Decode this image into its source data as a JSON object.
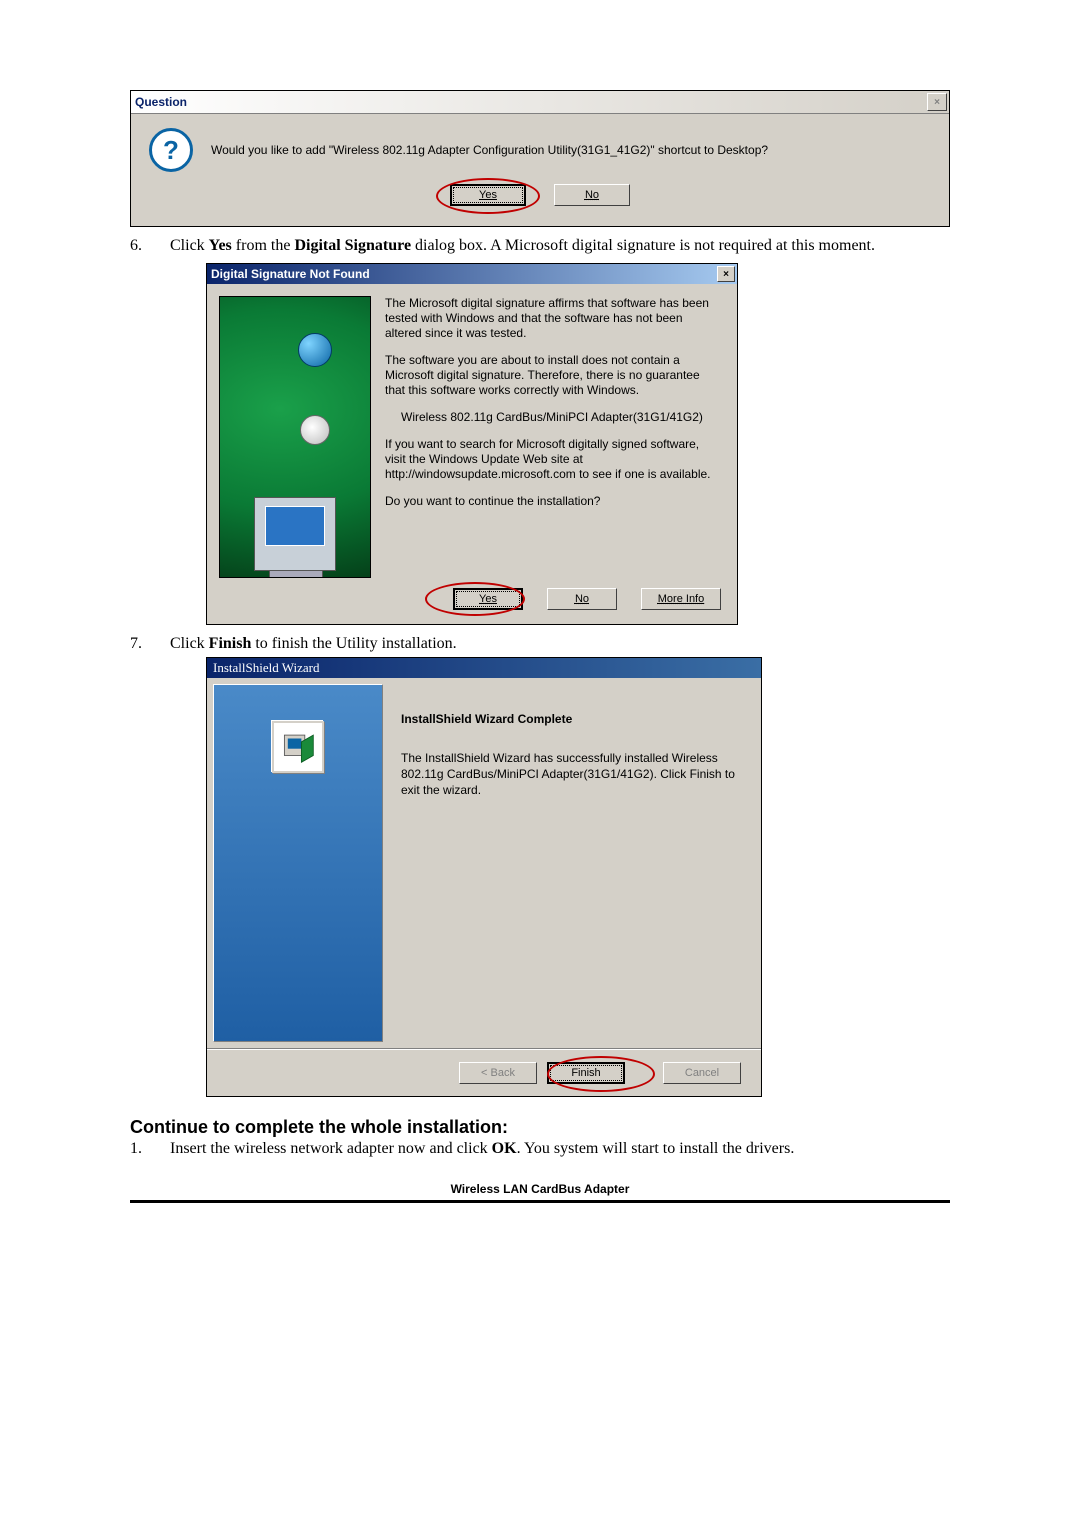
{
  "question_dialog": {
    "title": "Question",
    "icon_char": "?",
    "close_char": "×",
    "message": "Would you like to add \"Wireless 802.11g Adapter Configuration Utility(31G1_41G2)\" shortcut to Desktop?",
    "yes": "Yes",
    "no": "No"
  },
  "step6": {
    "num": "6.",
    "text_pre": "Click ",
    "bold1": "Yes",
    "text_mid": " from the ",
    "bold2": "Digital Signature",
    "text_post": " dialog box. A Microsoft digital signature is not required at this moment."
  },
  "signature_dialog": {
    "title": "Digital Signature Not Found",
    "close_char": "×",
    "p1": "The Microsoft digital signature affirms that software has been tested with Windows and that the software has not been altered since it was tested.",
    "p2": "The software you are about to install does not contain a Microsoft digital signature. Therefore,  there is no guarantee that this software works correctly with Windows.",
    "product": "Wireless 802.11g CardBus/MiniPCI Adapter(31G1/41G2)",
    "p3": "If you want to search for Microsoft digitally signed software, visit the Windows Update Web site at http://windowsupdate.microsoft.com to see if one is available.",
    "p4": "Do you want to continue the installation?",
    "yes": "Yes",
    "no": "No",
    "more": "More Info"
  },
  "step7": {
    "num": "7.",
    "text_pre": "Click ",
    "bold1": "Finish",
    "text_post": " to finish the Utility installation."
  },
  "wizard": {
    "title": "InstallShield Wizard",
    "heading": "InstallShield Wizard Complete",
    "body": "The InstallShield Wizard has successfully installed Wireless 802.11g CardBus/MiniPCI Adapter(31G1/41G2).  Click Finish to exit the wizard.",
    "back": "< Back",
    "finish": "Finish",
    "cancel": "Cancel"
  },
  "continue_heading": "Continue to complete the whole installation:",
  "continue_step1": {
    "num": "1.",
    "text_pre": "Insert the wireless network adapter now and click ",
    "bold1": "OK",
    "text_post": ". You system will start to install the drivers."
  },
  "footer": "Wireless LAN CardBus Adapter"
}
